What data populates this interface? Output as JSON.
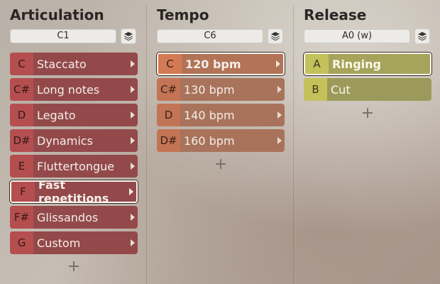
{
  "columns": [
    {
      "title": "Articulation",
      "key_field": "C1",
      "items": [
        {
          "key": "C",
          "label": "Staccato"
        },
        {
          "key": "C#",
          "label": "Long notes"
        },
        {
          "key": "D",
          "label": "Legato"
        },
        {
          "key": "D#",
          "label": "Dynamics"
        },
        {
          "key": "E",
          "label": "Fluttertongue"
        },
        {
          "key": "F",
          "label": "Fast repetitions",
          "selected": true
        },
        {
          "key": "F#",
          "label": "Glissandos"
        },
        {
          "key": "G",
          "label": "Custom"
        }
      ]
    },
    {
      "title": "Tempo",
      "key_field": "C6",
      "items": [
        {
          "key": "C",
          "label": "120 bpm",
          "selected": true
        },
        {
          "key": "C#",
          "label": "130 bpm"
        },
        {
          "key": "D",
          "label": "140 bpm"
        },
        {
          "key": "D#",
          "label": "160 bpm"
        }
      ]
    },
    {
      "title": "Release",
      "key_field": "A0 (w)",
      "items": [
        {
          "key": "A",
          "label": "Ringing",
          "selected": true
        },
        {
          "key": "B",
          "label": "Cut"
        }
      ]
    }
  ],
  "icons": {
    "layers": "layers-icon",
    "arrow": "chevron-right-icon",
    "add": "plus-icon"
  },
  "colors": {
    "articulation": "#93494a",
    "tempo": "#a9735b",
    "release": "#9c9a5a"
  }
}
